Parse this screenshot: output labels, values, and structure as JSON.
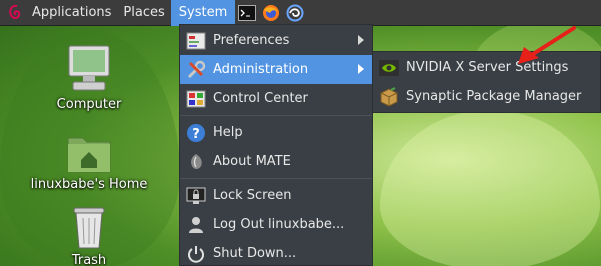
{
  "panel": {
    "applications_label": "Applications",
    "places_label": "Places",
    "system_label": "System"
  },
  "desktop": {
    "icons": [
      {
        "label": "Computer"
      },
      {
        "label": "linuxbabe's Home"
      },
      {
        "label": "Trash"
      }
    ]
  },
  "system_menu": {
    "items": [
      {
        "label": "Preferences"
      },
      {
        "label": "Administration"
      },
      {
        "label": "Control Center"
      },
      {
        "label": "Help"
      },
      {
        "label": "About MATE"
      },
      {
        "label": "Lock Screen"
      },
      {
        "label": "Log Out linuxbabe..."
      },
      {
        "label": "Shut Down..."
      }
    ]
  },
  "admin_submenu": {
    "items": [
      {
        "label": "NVIDIA X Server Settings"
      },
      {
        "label": "Synaptic Package Manager"
      }
    ]
  },
  "colors": {
    "highlight": "#5294e2",
    "panel": "#3c3c3c",
    "menu": "#393f45",
    "annotation_arrow": "#e8201a"
  }
}
